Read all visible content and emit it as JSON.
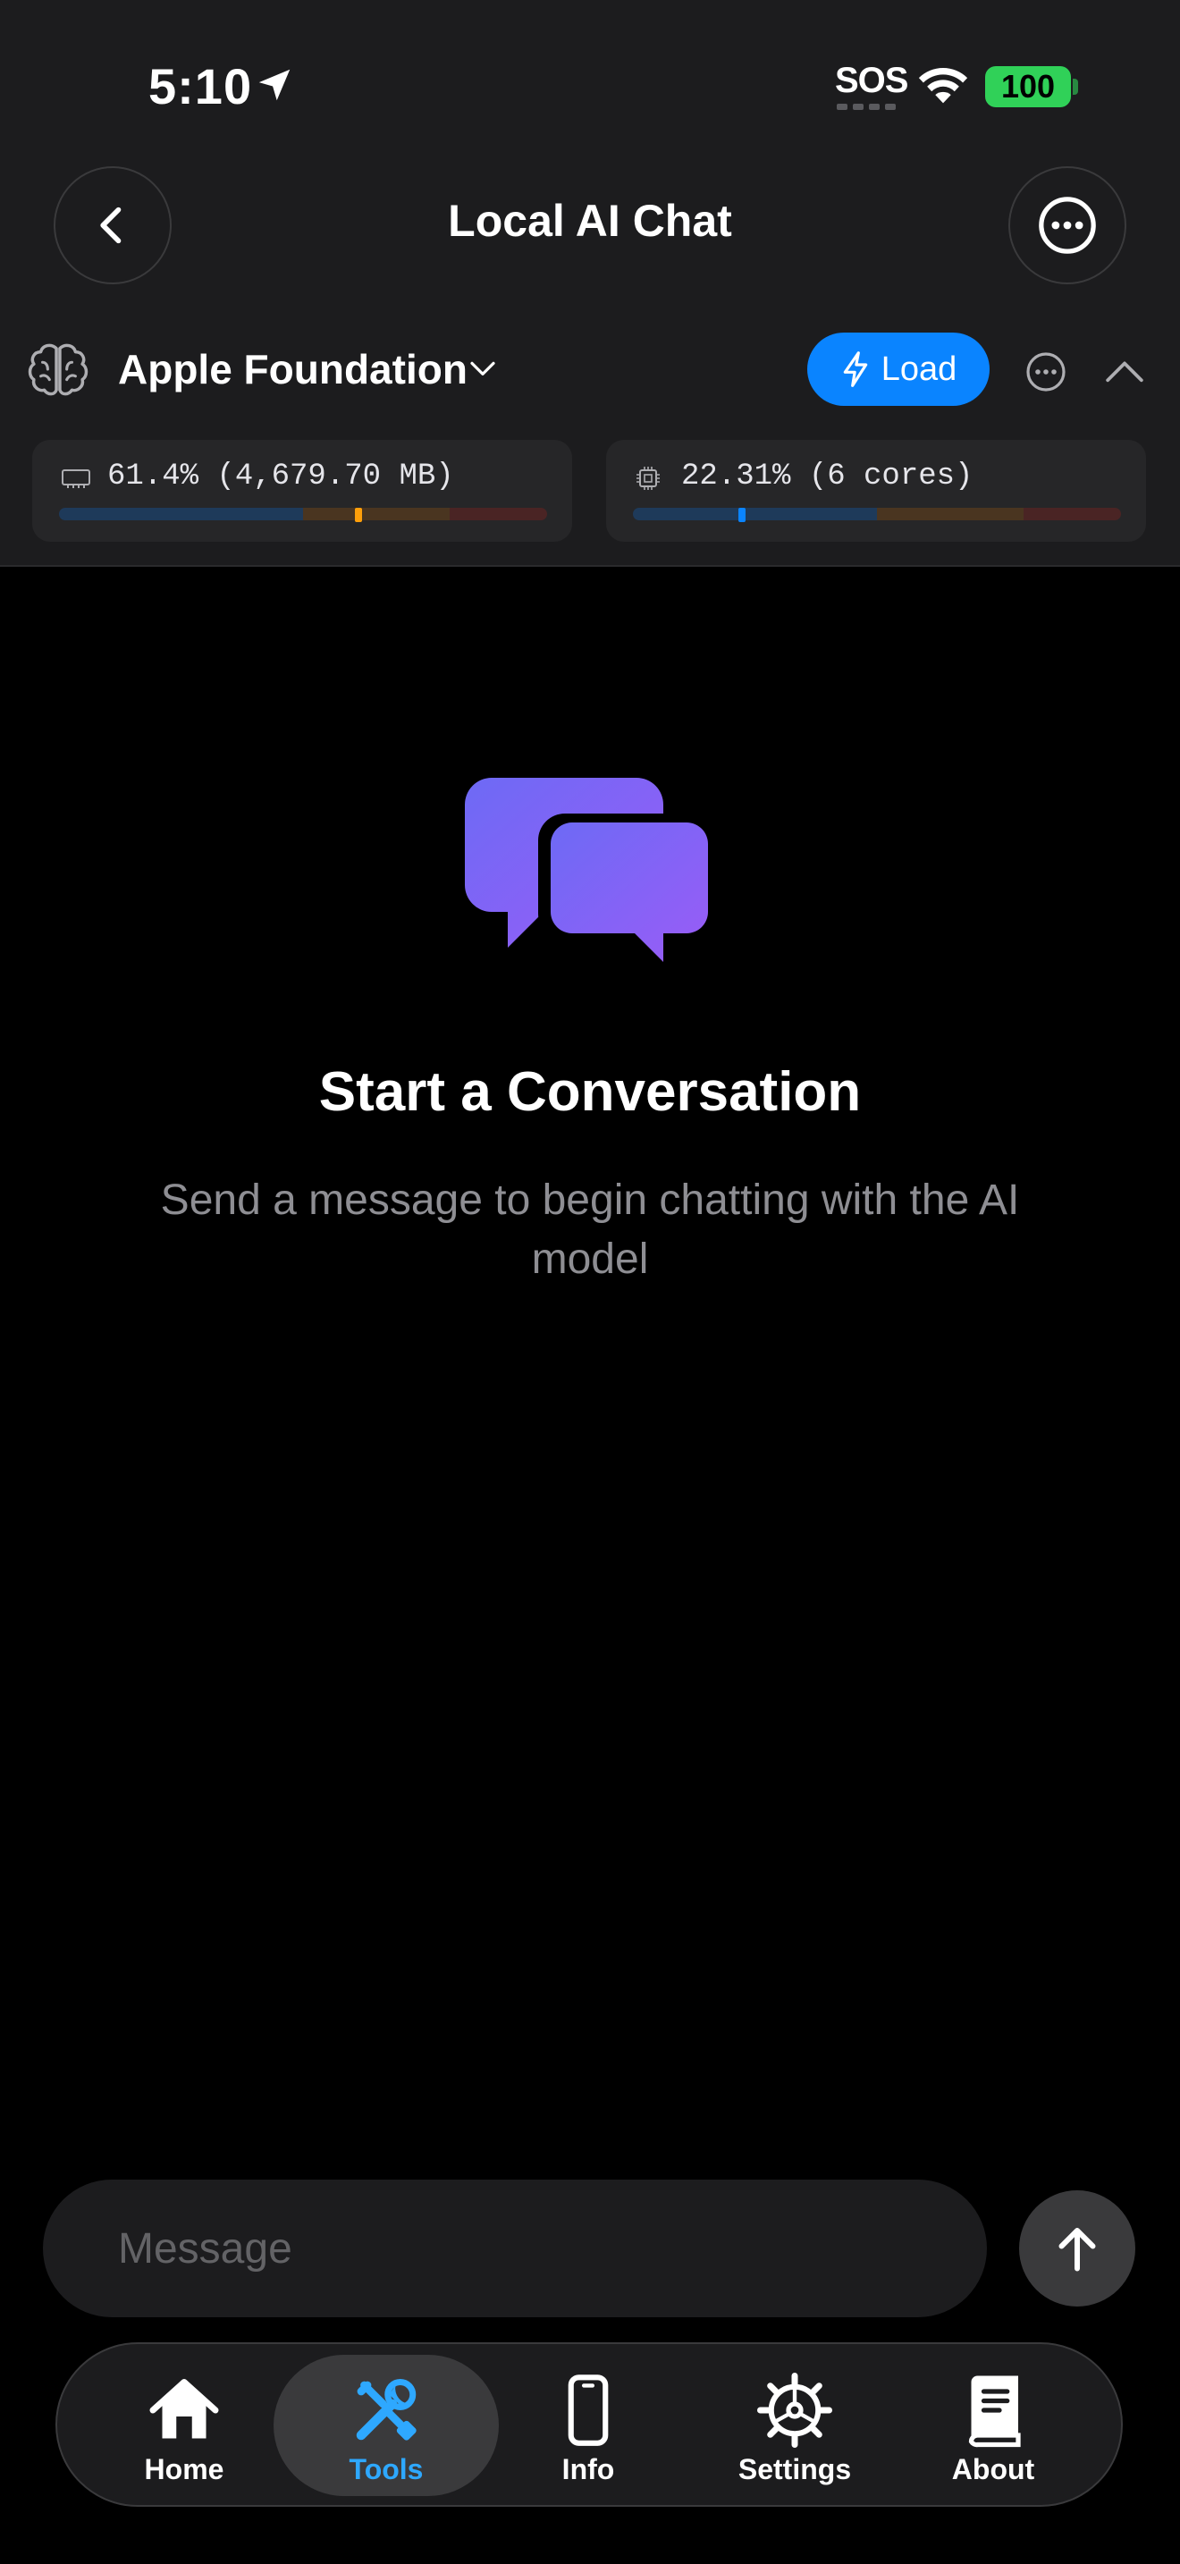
{
  "status_bar": {
    "time": "5:10",
    "sos": "SOS",
    "battery": "100"
  },
  "nav": {
    "title": "Local AI Chat"
  },
  "model": {
    "name": "Apple Foundation",
    "load_label": "Load"
  },
  "resources": {
    "memory": {
      "text": "61.4% (4,679.70 MB)",
      "fraction": 0.614
    },
    "cpu": {
      "text": "22.31% (6 cores)",
      "fraction": 0.2231
    }
  },
  "empty_state": {
    "title": "Start a Conversation",
    "subtitle": "Send a message to begin chatting with the AI model"
  },
  "composer": {
    "placeholder": "Message"
  },
  "tabs": [
    {
      "label": "Home",
      "icon": "house-icon",
      "active": false
    },
    {
      "label": "Tools",
      "icon": "tools-icon",
      "active": true
    },
    {
      "label": "Info",
      "icon": "phone-icon",
      "active": false
    },
    {
      "label": "Settings",
      "icon": "gear-icon",
      "active": false
    },
    {
      "label": "About",
      "icon": "book-icon",
      "active": false
    }
  ],
  "colors": {
    "accent": "#0a84ff",
    "tab_active": "#2ea8ff",
    "chat_icon": "#8b5cf6",
    "memory_marker": "#ff9f0a",
    "cpu_marker": "#0a84ff",
    "battery": "#30d158"
  }
}
